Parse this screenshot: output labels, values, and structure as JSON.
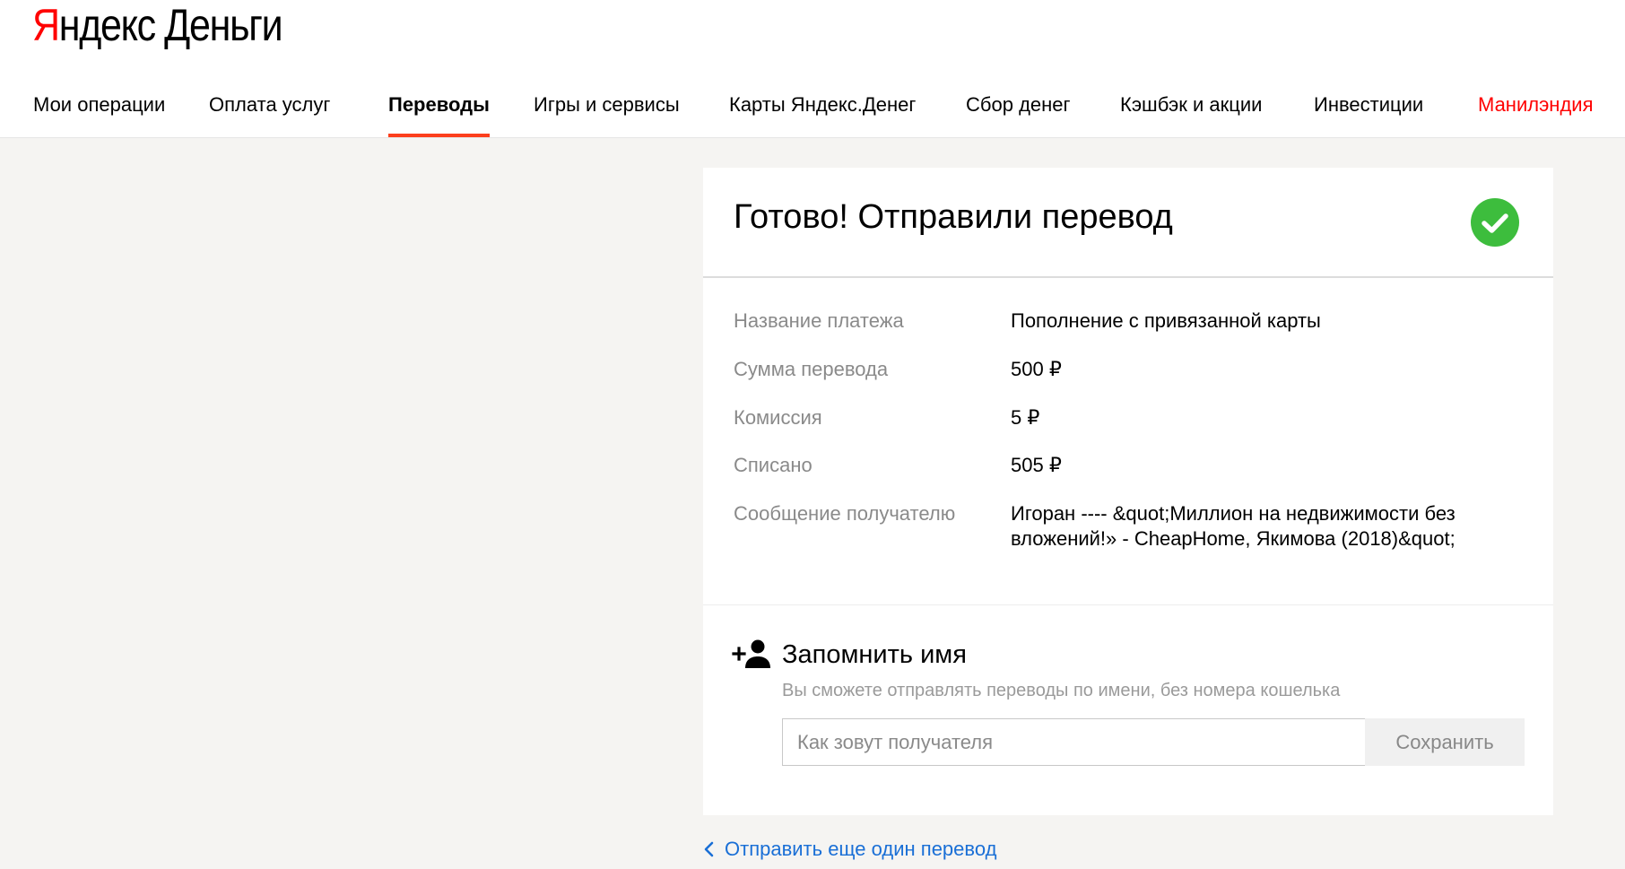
{
  "header": {
    "logo": {
      "first_letter": "Я",
      "rest": "ндекс",
      "service": "Деньги",
      "brand_color": "#ff0000"
    },
    "nav": [
      {
        "label": "Мои операции"
      },
      {
        "label": "Оплата услуг"
      },
      {
        "label": "Переводы",
        "active": true
      },
      {
        "label": "Игры и сервисы"
      },
      {
        "label": "Карты Яндекс.Денег"
      },
      {
        "label": "Сбор денег"
      },
      {
        "label": "Кэшбэк и акции"
      },
      {
        "label": "Инвестиции"
      },
      {
        "label": "Манилэндия",
        "color": "#ff0000"
      }
    ],
    "active_underline_color": "#fc3f1d"
  },
  "card": {
    "title": "Готово! Отправили перевод",
    "status_icon": "check-circle-icon",
    "status_color": "#3dbd3d",
    "details": [
      {
        "label": "Название платежа",
        "value": "Пополнение с привязанной карты"
      },
      {
        "label": "Сумма перевода",
        "value": "500 ₽"
      },
      {
        "label": "Комиссия",
        "value": "5 ₽"
      },
      {
        "label": "Списано",
        "value": "505 ₽"
      },
      {
        "label": "Сообщение получателю",
        "value": "Игоран ---- &quot;Миллион на недвижимости без вложений!» - CheapHome, Якимова (2018)&quot;"
      }
    ],
    "remember": {
      "icon": "add-person-icon",
      "title": "Запомнить имя",
      "hint": "Вы сможете отправлять переводы по имени, без номера кошелька",
      "input_placeholder": "Как зовут получателя",
      "input_value": "",
      "save_label": "Сохранить"
    }
  },
  "back_link": {
    "icon": "chevron-left-icon",
    "label": "Отправить еще один перевод",
    "color": "#1a6fd6"
  }
}
